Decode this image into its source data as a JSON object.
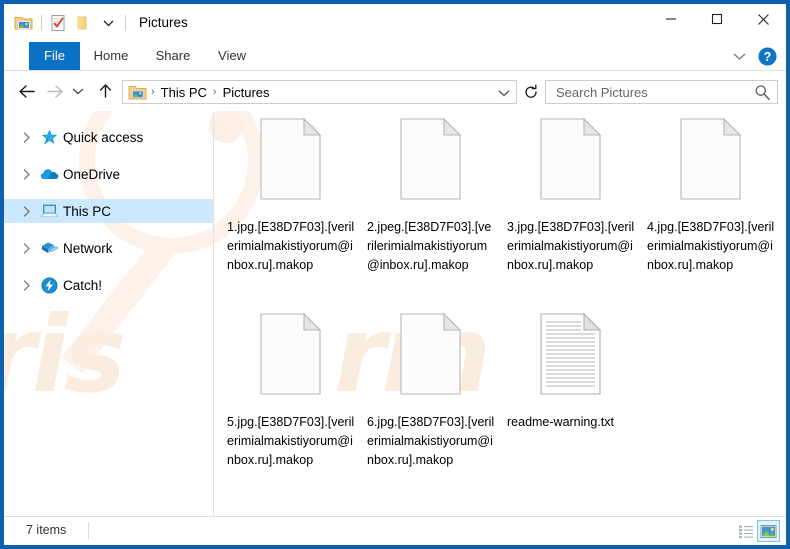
{
  "window": {
    "title": "Pictures",
    "minimize_label": "Minimize",
    "maximize_label": "Maximize",
    "close_label": "Close",
    "frame_color": "#0c62b0"
  },
  "quick_access_toolbar": {
    "items": [
      {
        "name": "properties-icon",
        "label": "Properties"
      },
      {
        "name": "new-folder-icon",
        "label": "New folder"
      },
      {
        "name": "customize-chevron-icon",
        "label": "Customize Quick Access Toolbar"
      }
    ]
  },
  "ribbon": {
    "tabs": [
      {
        "label": "File",
        "selected": true
      },
      {
        "label": "Home",
        "selected": false
      },
      {
        "label": "Share",
        "selected": false
      },
      {
        "label": "View",
        "selected": false
      }
    ],
    "expand_label": "Expand the Ribbon",
    "help_label": "Help",
    "accent_color": "#0b71c5"
  },
  "navigation": {
    "back_label": "Back",
    "forward_label": "Forward",
    "recent_label": "Recent locations",
    "up_label": "Up"
  },
  "address_bar": {
    "crumbs": [
      "This PC",
      "Pictures"
    ],
    "separator": "›",
    "dropdown_label": "Previous locations",
    "refresh_label": "Refresh"
  },
  "search": {
    "placeholder": "Search Pictures",
    "value": ""
  },
  "sidebar": {
    "items": [
      {
        "label": "Quick access",
        "icon": "star-pin-icon",
        "selected": false
      },
      {
        "label": "OneDrive",
        "icon": "cloud-icon",
        "selected": false
      },
      {
        "label": "This PC",
        "icon": "this-pc-icon",
        "selected": true
      },
      {
        "label": "Network",
        "icon": "network-icon",
        "selected": false
      },
      {
        "label": "Catch!",
        "icon": "catch-icon",
        "selected": false
      }
    ],
    "highlight_color": "#cce8ff"
  },
  "files": [
    {
      "name": "1.jpg.[E38D7F03].[verilerimialmakistiyorum@inbox.ru].makop",
      "icon": "blank-file-icon"
    },
    {
      "name": "2.jpeg.[E38D7F03].[verilerimialmakistiyorum@inbox.ru].makop",
      "icon": "blank-file-icon"
    },
    {
      "name": "3.jpg.[E38D7F03].[verilerimialmakistiyorum@inbox.ru].makop",
      "icon": "blank-file-icon"
    },
    {
      "name": "4.jpg.[E38D7F03].[verilerimialmakistiyorum@inbox.ru].makop",
      "icon": "blank-file-icon"
    },
    {
      "name": "5.jpg.[E38D7F03].[verilerimialmakistiyorum@inbox.ru].makop",
      "icon": "blank-file-icon"
    },
    {
      "name": "6.jpg.[E38D7F03].[verilerimialmakistiyorum@inbox.ru].makop",
      "icon": "blank-file-icon"
    },
    {
      "name": "readme-warning.txt",
      "icon": "text-file-icon"
    }
  ],
  "status_bar": {
    "item_count": "7 items",
    "views": [
      {
        "name": "details-view-button",
        "label": "Details",
        "active": false
      },
      {
        "name": "large-icons-view-button",
        "label": "Large icons",
        "active": true
      }
    ]
  },
  "watermark": {
    "text_left": "ris",
    "text_right": "rm"
  }
}
